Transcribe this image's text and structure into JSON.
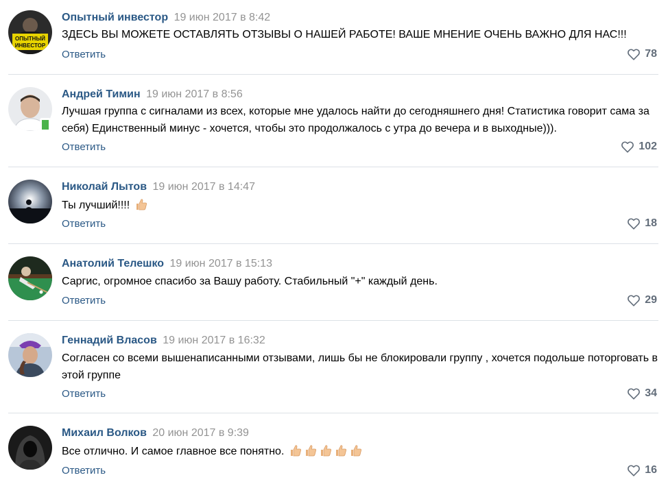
{
  "comments": [
    {
      "author": "Опытный инвестор",
      "date": "19 июн 2017 в 8:42",
      "text": "ЗДЕСЬ ВЫ МОЖЕТЕ ОСТАВЛЯТЬ ОТЗЫВЫ О НАШЕЙ РАБОТЕ! ВАШЕ МНЕНИЕ ОЧЕНЬ ВАЖНО ДЛЯ НАС!!!",
      "reply": "Ответить",
      "likes": "78",
      "avatar_lines": [
        "ОПЫТНЫЙ",
        "ИНВЕСТОР"
      ]
    },
    {
      "author": "Андрей Тимин",
      "date": "19 июн 2017 в 8:56",
      "text": "Лучшая группа с сигналами из всех, которые мне удалось найти до сегодняшнего дня! Статистика говорит сама за себя) Единственный минус - хочется, чтобы это продолжалось с утра до вечера и в выходные))).",
      "reply": "Ответить",
      "likes": "102"
    },
    {
      "author": "Николай Лытов",
      "date": "19 июн 2017 в 14:47",
      "text": "Ты лучший!!!!",
      "reply": "Ответить",
      "likes": "18"
    },
    {
      "author": "Анатолий Телешко",
      "date": "19 июн 2017 в 15:13",
      "text": "Саргис, огромное спасибо за Вашу работу. Стабильный \"+\" каждый день.",
      "reply": "Ответить",
      "likes": "29"
    },
    {
      "author": "Геннадий Власов",
      "date": "19 июн 2017 в 16:32",
      "text": "Согласен со всеми вышенаписанными отзывами, лишь бы не блокировали группу , хочется подольше поторговать в этой группе",
      "reply": "Ответить",
      "likes": "34"
    },
    {
      "author": "Михаил Волков",
      "date": "20 июн 2017 в 9:39",
      "text": "Все отлично. И самое главное все понятно.",
      "reply": "Ответить",
      "likes": "16"
    }
  ],
  "colors": {
    "link": "#2a5885",
    "date": "#939393",
    "divider": "#dce1e6",
    "likes": "#626d7a",
    "online": "#4bb34b"
  },
  "icons": {
    "like": "heart-outline-icon",
    "emoji": "thumbs-up-icon"
  }
}
